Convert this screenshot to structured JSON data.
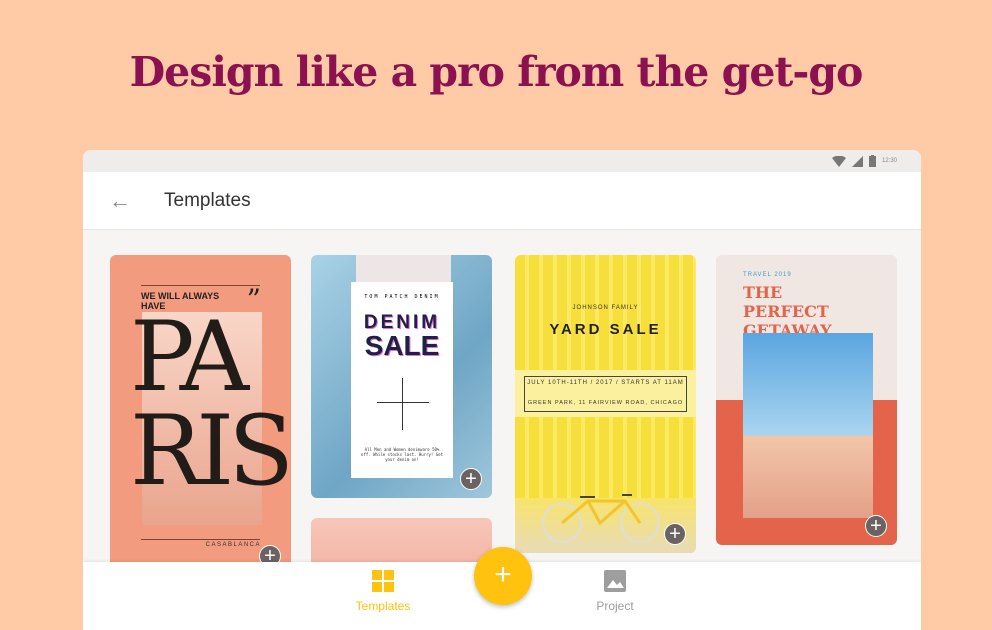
{
  "headline": "Design like a pro from the get-go",
  "status_bar": {
    "time": "12:30"
  },
  "app_bar": {
    "title": "Templates"
  },
  "templates": [
    {
      "name": "paris",
      "top_text": "WE WILL ALWAYS HAVE",
      "quote_mark": "”",
      "title_line1": "PA",
      "title_line2": "RIS",
      "footer": "CASABLANCA"
    },
    {
      "name": "denim-sale",
      "brand": "TOM PATCH DENIM",
      "title_line1": "DENIM",
      "title_line2": "SALE",
      "fine_print": "All Men and Women denimware 50% off. While stocks last. Hurry! Get your denim on!"
    },
    {
      "name": "yard-sale",
      "family": "JOHNSON FAMILY",
      "title": "YARD SALE",
      "date_line": "JULY 10TH-11TH / 2017 / STARTS AT 11AM",
      "location_line": "GREEN PARK, 11 FAIRVIEW ROAD, CHICAGO"
    },
    {
      "name": "perfect-getaway",
      "kicker": "TRAVEL 2019",
      "title": "THE PERFECT GETAWAY"
    }
  ],
  "bottom_nav": {
    "items": [
      {
        "label": "Templates",
        "active": true,
        "color": "#FFC20E"
      },
      {
        "label": "Project",
        "active": false,
        "color": "#9e9e9e"
      }
    ],
    "fab": "+"
  },
  "colors": {
    "background": "#FFCBA6",
    "headline": "#8C1150",
    "accent": "#FFC20E"
  }
}
